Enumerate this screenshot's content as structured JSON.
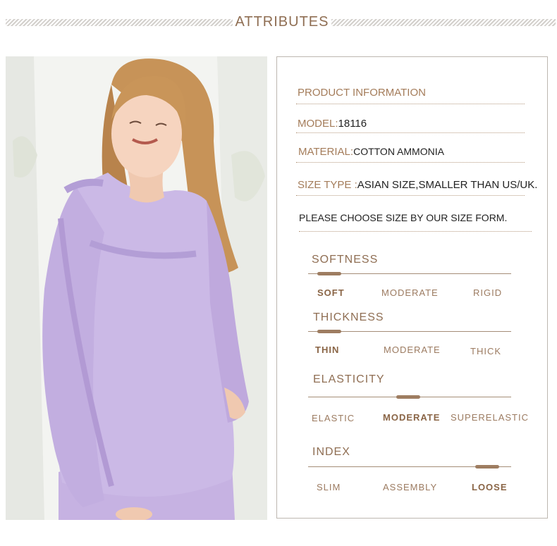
{
  "header": {
    "title": "ATTRIBUTES"
  },
  "product": {
    "heading": "PRODUCT INFORMATION",
    "model_label": "MODEL:",
    "model_value": "18116",
    "material_label": "MATERIAL:",
    "material_value": "COTTON AMMONIA",
    "size_type_label": "SIZE TYPE :",
    "size_type_value": "ASIAN SIZE,SMALLER THAN US/UK.",
    "size_note": "PLEASE CHOOSE SIZE BY OUR SIZE FORM."
  },
  "ratings": {
    "softness": {
      "title": "SOFTNESS",
      "options": [
        "SOFT",
        "MODERATE",
        "RIGID"
      ],
      "selected": "SOFT"
    },
    "thickness": {
      "title": "THICKNESS",
      "options": [
        "THIN",
        "MODERATE",
        "THICK"
      ],
      "selected": "THIN"
    },
    "elasticity": {
      "title": "ELASTICITY",
      "options": [
        "ELASTIC",
        "MODERATE",
        "SUPERELASTIC"
      ],
      "selected": "MODERATE"
    },
    "index": {
      "title": "INDEX",
      "options": [
        "SLIM",
        "ASSEMBLY",
        "LOOSE"
      ],
      "selected": "LOOSE"
    }
  },
  "colors": {
    "accent": "#a47c5a",
    "garment": "#c7b5e3"
  }
}
